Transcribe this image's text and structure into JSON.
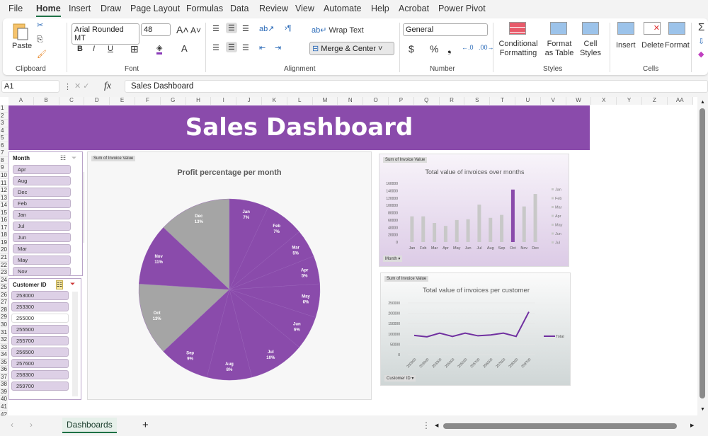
{
  "menu": [
    "File",
    "Home",
    "Insert",
    "Draw",
    "Page Layout",
    "Formulas",
    "Data",
    "Review",
    "View",
    "Automate",
    "Help",
    "Acrobat",
    "Power Pivot"
  ],
  "ribbon": {
    "paste": "Paste",
    "clipboard": "Clipboard",
    "font_name": "Arial Rounded MT",
    "font_size": "48",
    "font": "Font",
    "bold": "B",
    "italic": "I",
    "underline": "U",
    "alignment": "Alignment",
    "wrap_text": "Wrap Text",
    "merge_center": "Merge & Center",
    "number_format": "General",
    "number": "Number",
    "currency": "$",
    "percent": "%",
    "comma": "❟",
    "cond_fmt": "Conditional Formatting",
    "fmt_table": "Format as Table",
    "cell_styles": "Cell Styles",
    "styles": "Styles",
    "insert": "Insert",
    "delete": "Delete",
    "format": "Format",
    "cells": "Cells"
  },
  "formula_bar": {
    "name_box": "A1",
    "fx": "fx",
    "value": "Sales Dashboard"
  },
  "columns": [
    "A",
    "B",
    "C",
    "D",
    "E",
    "F",
    "G",
    "H",
    "I",
    "J",
    "K",
    "L",
    "M",
    "N",
    "O",
    "P",
    "Q",
    "R",
    "S",
    "T",
    "U",
    "V",
    "W",
    "X",
    "Y",
    "Z",
    "AA"
  ],
  "rows": [
    "1",
    "2",
    "3",
    "4",
    "5",
    "6",
    "7",
    "8",
    "9",
    "10",
    "11",
    "12",
    "13",
    "14",
    "15",
    "16",
    "17",
    "18",
    "19",
    "20",
    "21",
    "22",
    "23",
    "24",
    "25",
    "26",
    "27",
    "28",
    "29",
    "30",
    "31",
    "32",
    "33",
    "34",
    "35",
    "36",
    "37",
    "38",
    "39",
    "40",
    "41",
    "42"
  ],
  "banner": "Sales Dashboard",
  "month_slicer": {
    "title": "Month",
    "items": [
      "Apr",
      "Aug",
      "Dec",
      "Feb",
      "Jan",
      "Jul",
      "Jun",
      "Mar",
      "May",
      "Nov"
    ]
  },
  "customer_slicer": {
    "title": "Customer ID",
    "items": [
      "253000",
      "253300",
      "255000",
      "255500",
      "255700",
      "256500",
      "257600",
      "258300",
      "259700"
    ],
    "unselected": [
      "255000"
    ]
  },
  "colors": {
    "purple": "#8a4bab",
    "gray": "#a5a5a5"
  },
  "chart_data": [
    {
      "type": "pie",
      "title": "Profit percentage per month",
      "field_button": "Sum of Invoice Value",
      "categories": [
        "Jan",
        "Feb",
        "Mar",
        "Apr",
        "May",
        "Jun",
        "Jul",
        "Aug",
        "Sep",
        "Oct",
        "Nov",
        "Dec"
      ],
      "values": [
        7,
        7,
        5,
        5,
        6,
        6,
        10,
        8,
        9,
        13,
        11,
        13
      ],
      "labels": [
        "7%",
        "7%",
        "5%",
        "5%",
        "6%",
        "6%",
        "10%",
        "8%",
        "9%",
        "13%",
        "11%",
        "13%"
      ],
      "slice_colors": [
        "#8a4bab",
        "#8a4bab",
        "#8a4bab",
        "#8a4bab",
        "#8a4bab",
        "#8a4bab",
        "#8a4bab",
        "#8a4bab",
        "#8a4bab",
        "#a5a5a5",
        "#8a4bab",
        "#a5a5a5"
      ]
    },
    {
      "type": "bar",
      "title": "Total value of invoices over months",
      "field_button": "Sum of Invoice Value",
      "axis_button": "Month",
      "categories": [
        "Jan",
        "Feb",
        "Mar",
        "Apr",
        "May",
        "Jun",
        "Jul",
        "Aug",
        "Sep",
        "Oct",
        "Nov",
        "Dec"
      ],
      "values": [
        70000,
        70000,
        52000,
        44000,
        60000,
        62000,
        102000,
        66000,
        74000,
        143000,
        97000,
        131000
      ],
      "highlight": "Oct",
      "ylim": [
        0,
        160000
      ],
      "yticks": [
        "0",
        "20000",
        "40000",
        "60000",
        "80000",
        "100000",
        "120000",
        "140000",
        "160000"
      ],
      "legend": [
        "Jan",
        "Feb",
        "Mar",
        "Apr",
        "May",
        "Jun",
        "Jul"
      ],
      "legend_position": "right"
    },
    {
      "type": "line",
      "title": "Total value of invoices per customer",
      "field_button": "Sum of Invoice Value",
      "axis_button": "Customer ID",
      "categories": [
        "250900",
        "253000",
        "253300",
        "255000",
        "255500",
        "255700",
        "256500",
        "257600",
        "258300",
        "259700"
      ],
      "series": [
        {
          "name": "Total",
          "values": [
            93000,
            86000,
            104000,
            88000,
            104000,
            91000,
            95000,
            104000,
            88000,
            207000
          ]
        }
      ],
      "ylim": [
        0,
        250000
      ],
      "yticks": [
        "0",
        "50000",
        "100000",
        "150000",
        "200000",
        "250000"
      ],
      "legend_position": "right"
    }
  ],
  "sheet_tab": "Dashboards"
}
